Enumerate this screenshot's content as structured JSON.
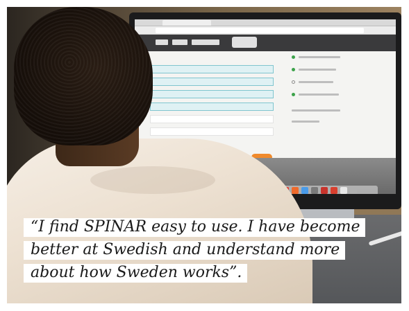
{
  "caption": {
    "line1": "“I find SPINAR easy to use. I have become",
    "line2": "better at Swedish and understand more",
    "line3": "about how Sweden works”."
  }
}
